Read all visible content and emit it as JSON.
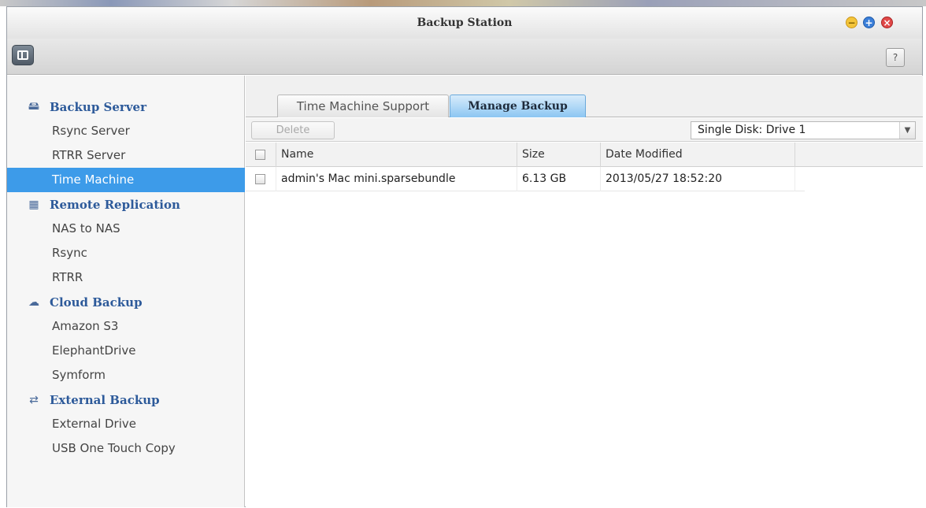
{
  "window": {
    "title": "Backup Station"
  },
  "toolbar": {
    "help_label": "?"
  },
  "sidebar": {
    "groups": [
      {
        "label": "Backup Server",
        "icon": "server-icon",
        "items": [
          "Rsync Server",
          "RTRR Server",
          "Time Machine"
        ]
      },
      {
        "label": "Remote Replication",
        "icon": "replication-icon",
        "items": [
          "NAS to NAS",
          "Rsync",
          "RTRR"
        ]
      },
      {
        "label": "Cloud Backup",
        "icon": "cloud-icon",
        "items": [
          "Amazon S3",
          "ElephantDrive",
          "Symform"
        ]
      },
      {
        "label": "External Backup",
        "icon": "sync-arrows-icon",
        "items": [
          "External Drive",
          "USB One Touch Copy"
        ]
      }
    ],
    "active_item": "Time Machine"
  },
  "tabs": [
    {
      "label": "Time Machine Support",
      "active": false
    },
    {
      "label": "Manage Backup",
      "active": true
    }
  ],
  "actions": {
    "delete_label": "Delete",
    "disk_select_value": "Single Disk: Drive  1"
  },
  "table": {
    "columns": [
      "Name",
      "Size",
      "Date Modified"
    ],
    "rows": [
      {
        "name": "admin's Mac mini.sparsebundle",
        "size": "6.13 GB",
        "date_modified": "2013/05/27 18:52:20"
      }
    ]
  },
  "colors": {
    "accent": "#3d9be9",
    "group_header": "#2d5a9a"
  }
}
